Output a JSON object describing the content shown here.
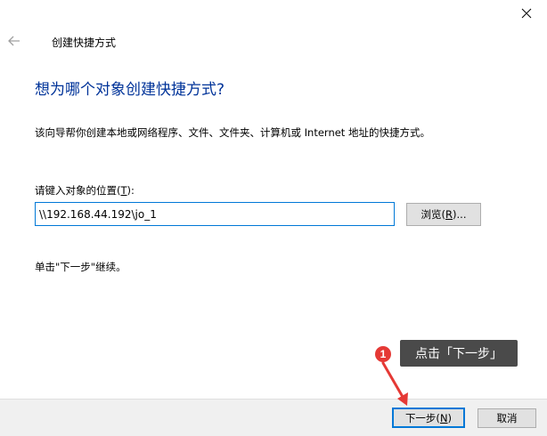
{
  "window": {
    "title": "创建快捷方式",
    "close_icon": "×"
  },
  "page": {
    "heading": "想为哪个对象创建快捷方式?",
    "description": "该向导帮你创建本地或网络程序、文件、文件夹、计算机或 Internet 地址的快捷方式。",
    "location_label": "请键入对象的位置(T):",
    "location_value": "\\\\192.168.44.192\\jo_1",
    "browse_label": "浏览(R)...",
    "hint": "单击\"下一步\"继续。"
  },
  "footer": {
    "next_label": "下一步(N)",
    "cancel_label": "取消"
  },
  "annotation": {
    "step_number": "1",
    "callout_text": "点击「下一步」",
    "badge_color": "#e53935",
    "callout_color": "#4a4a4a"
  }
}
